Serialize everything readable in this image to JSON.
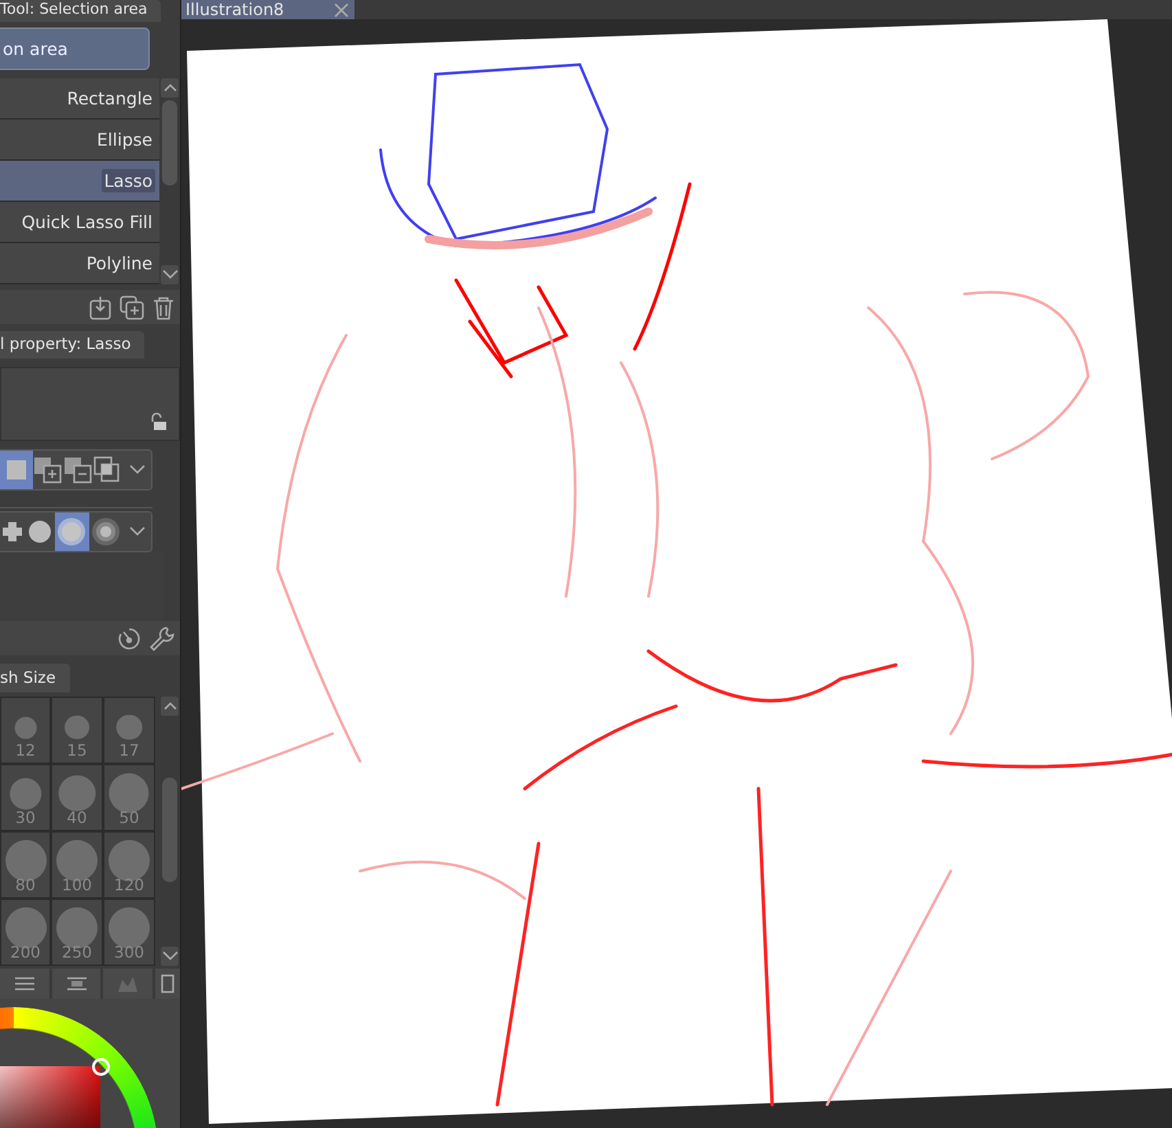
{
  "tool_panel": {
    "tab": "Tool: Selection area",
    "group": "on area",
    "items": [
      {
        "label": "Rectangle",
        "selected": false
      },
      {
        "label": "Ellipse",
        "selected": false
      },
      {
        "label": "Lasso",
        "selected": true
      },
      {
        "label": "Quick Lasso Fill",
        "selected": false
      },
      {
        "label": "Polyline",
        "selected": false
      }
    ]
  },
  "property_panel": {
    "tab": "l property: Lasso",
    "selection_modes": [
      {
        "kind": "new",
        "selected": true
      },
      {
        "kind": "add",
        "selected": false
      },
      {
        "kind": "subtract",
        "selected": false
      },
      {
        "kind": "intersect",
        "selected": false
      }
    ],
    "anti_aliasing": [
      {
        "kind": "none",
        "selected": false
      },
      {
        "kind": "weak",
        "selected": false
      },
      {
        "kind": "medium",
        "selected": true
      },
      {
        "kind": "strong",
        "selected": false
      }
    ]
  },
  "brush_size": {
    "tab": "sh Size",
    "sizes": [
      "12",
      "15",
      "17",
      "30",
      "40",
      "50",
      "80",
      "100",
      "120",
      "200",
      "250",
      "300"
    ]
  },
  "canvas": {
    "tab": "Illustration8"
  }
}
